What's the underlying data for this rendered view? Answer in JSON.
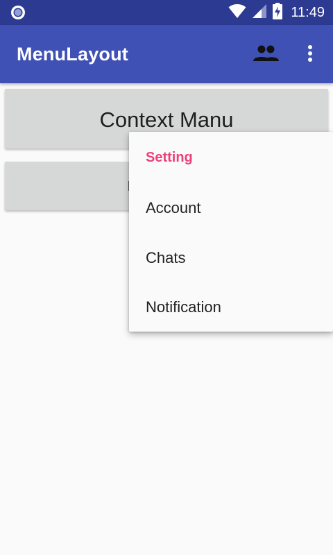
{
  "status_bar": {
    "time": "11:49",
    "icons": [
      "circle-notification-icon",
      "wifi-icon",
      "signal-icon",
      "battery-charging-icon"
    ]
  },
  "app_bar": {
    "title": "MenuLayout",
    "actions": [
      "people-icon",
      "overflow-menu-icon"
    ],
    "color": "#3f51b5"
  },
  "buttons": {
    "context_menu_label": "Context Manu",
    "second_label_visible": "P"
  },
  "popup_menu": {
    "header": "Setting",
    "header_color": "#ec407a",
    "items": [
      "Account",
      "Chats",
      "Notification"
    ]
  }
}
